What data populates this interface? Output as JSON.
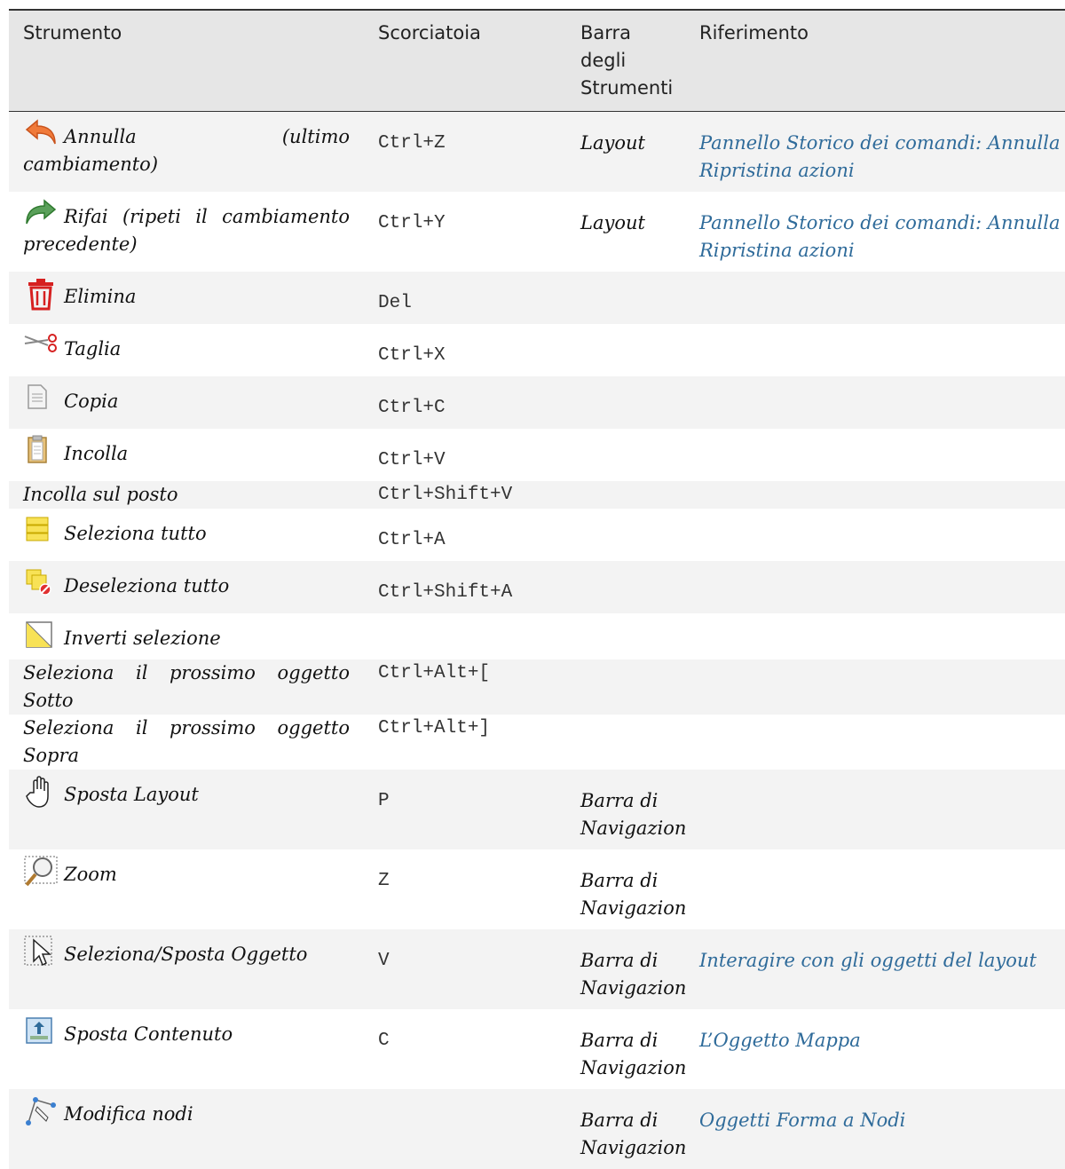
{
  "columns": {
    "tool": "Strumento",
    "shortcut": "Scorciatoia",
    "toolbar": "Barra degli Strumenti",
    "reference": "Riferimento"
  },
  "rows": [
    {
      "icon": "undo-icon",
      "tool": "Annulla (ultimo cambiamento)",
      "shortcut": "Ctrl+Z",
      "toolbar": "Layout",
      "reference": "Pannello Storico dei comandi: Annulla e Ripristina azioni"
    },
    {
      "icon": "redo-icon",
      "tool": "Rifai (ripeti il cambiamento precedente)",
      "shortcut": "Ctrl+Y",
      "toolbar": "Layout",
      "reference": "Pannello Storico dei comandi: Annulla e Ripristina azioni"
    },
    {
      "icon": "trash-icon",
      "tool": "Elimina",
      "shortcut": "Del",
      "toolbar": "",
      "reference": ""
    },
    {
      "icon": "scissors-icon",
      "tool": "Taglia",
      "shortcut": "Ctrl+X",
      "toolbar": "",
      "reference": ""
    },
    {
      "icon": "copy-icon",
      "tool": "Copia",
      "shortcut": "Ctrl+C",
      "toolbar": "",
      "reference": ""
    },
    {
      "icon": "paste-icon",
      "tool": "Incolla",
      "shortcut": "Ctrl+V",
      "toolbar": "",
      "reference": ""
    },
    {
      "icon": "",
      "tool": "Incolla sul posto",
      "shortcut": "Ctrl+Shift+V",
      "toolbar": "",
      "reference": ""
    },
    {
      "icon": "select-all-icon",
      "tool": "Seleziona tutto",
      "shortcut": "Ctrl+A",
      "toolbar": "",
      "reference": ""
    },
    {
      "icon": "deselect-all-icon",
      "tool": "Deseleziona tutto",
      "shortcut": "Ctrl+Shift+A",
      "toolbar": "",
      "reference": ""
    },
    {
      "icon": "invert-selection-icon",
      "tool": "Inverti selezione",
      "shortcut": "",
      "toolbar": "",
      "reference": ""
    },
    {
      "icon": "",
      "tool": "Seleziona il prossimo oggetto Sotto",
      "shortcut": "Ctrl+Alt+[",
      "toolbar": "",
      "reference": ""
    },
    {
      "icon": "",
      "tool": "Seleziona il prossimo oggetto Sopra",
      "shortcut": "Ctrl+Alt+]",
      "toolbar": "",
      "reference": ""
    },
    {
      "icon": "pan-hand-icon",
      "tool": "Sposta Layout",
      "shortcut": "P",
      "toolbar": "Barra di Navigazione",
      "reference": ""
    },
    {
      "icon": "zoom-icon",
      "tool": "Zoom",
      "shortcut": "Z",
      "toolbar": "Barra di Navigazione",
      "reference": ""
    },
    {
      "icon": "select-move-icon",
      "tool": "Seleziona/Sposta Oggetto",
      "shortcut": "V",
      "toolbar": "Barra di Navigazione",
      "reference": "Interagire con gli oggetti del layout"
    },
    {
      "icon": "move-content-icon",
      "tool": "Sposta Contenuto",
      "shortcut": "C",
      "toolbar": "Barra di Navigazione",
      "reference": "L’Oggetto Mappa"
    },
    {
      "icon": "edit-nodes-icon",
      "tool": "Modifica nodi",
      "shortcut": "",
      "toolbar": "Barra di Navigazione",
      "reference": "Oggetti Forma a Nodi"
    }
  ]
}
